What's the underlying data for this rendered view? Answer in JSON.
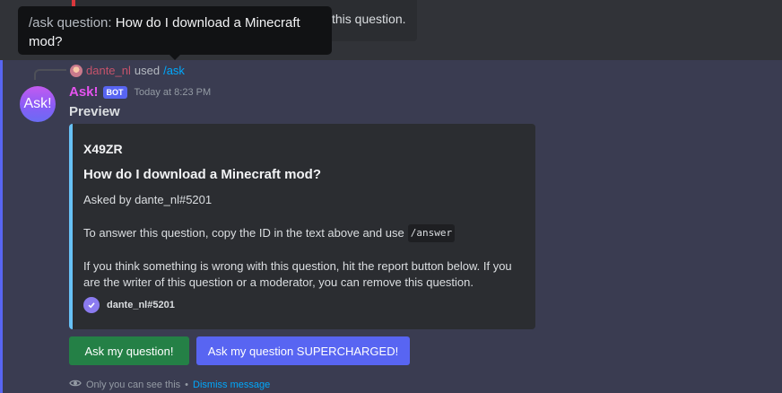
{
  "previous_message": {
    "tail_text": "this question."
  },
  "tooltip": {
    "label": "/ask question: ",
    "value": "How do I download a Minecraft mod?"
  },
  "command": {
    "user": "dante_nl",
    "used": "used",
    "command_name": "/ask"
  },
  "message": {
    "avatar_text": "Ask!",
    "username": "Ask!",
    "badge": "BOT",
    "timestamp": "Today at 8:23 PM",
    "content": "Preview"
  },
  "embed": {
    "accent_color": "#67c1f5",
    "id": "X49ZR",
    "title": "How do I download a Minecraft mod?",
    "asked_by": "Asked by dante_nl#5201",
    "answer_text": "To answer this question, copy the ID in the text above and use",
    "answer_code": "/answer",
    "report_text": "If you think something is wrong with this question, hit the report button below. If you are the writer of this question or a moderator, you can remove this question.",
    "footer_icon": "verified-check-icon",
    "footer_text": "dante_nl#5201"
  },
  "buttons": {
    "ask_label": "Ask my question!",
    "ask_color": "#248046",
    "supercharged_label": "Ask my question SUPERCHARGED!",
    "supercharged_color": "#5865f2"
  },
  "ephemeral": {
    "icon": "eye-icon",
    "note": "Only you can see this",
    "separator": "•",
    "dismiss": "Dismiss message"
  }
}
